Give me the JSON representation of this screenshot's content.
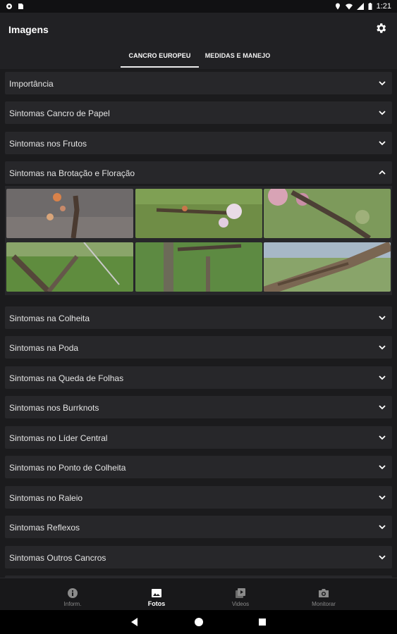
{
  "status_bar": {
    "time": "1:21",
    "icons": [
      "settings-notif-icon",
      "sd-card-icon",
      "location-icon",
      "wifi-icon",
      "signal-icon",
      "battery-icon"
    ]
  },
  "app_bar": {
    "title": "Imagens",
    "settings_icon": "gear-icon"
  },
  "tabs": [
    {
      "label": "CANCRO EUROPEU",
      "selected": true
    },
    {
      "label": "MEDIDAS E MANEJO",
      "selected": false
    }
  ],
  "sections": [
    {
      "label": "Importância",
      "expanded": false
    },
    {
      "label": "Sintomas Cancro de Papel",
      "expanded": false
    },
    {
      "label": "Sintomas nos Frutos",
      "expanded": false
    },
    {
      "label": "Sintomas na Brotação e Floração",
      "expanded": true
    },
    {
      "label": "Sintomas na Colheita",
      "expanded": false
    },
    {
      "label": "Sintomas na Poda",
      "expanded": false
    },
    {
      "label": "Sintomas na Queda de Folhas",
      "expanded": false
    },
    {
      "label": "Sintomas nos Burrknots",
      "expanded": false
    },
    {
      "label": "Sintomas no Líder Central",
      "expanded": false
    },
    {
      "label": "Sintomas no Ponto de Colheita",
      "expanded": false
    },
    {
      "label": "Sintomas no Raleio",
      "expanded": false
    },
    {
      "label": "Sintomas Reflexos",
      "expanded": false
    },
    {
      "label": "Sintomas Outros Cancros",
      "expanded": false
    }
  ],
  "gallery": {
    "thumbnails": [
      "photo-1",
      "photo-2",
      "photo-3",
      "photo-4",
      "photo-5",
      "photo-6"
    ]
  },
  "bottom_nav": [
    {
      "label": "Inform.",
      "icon": "info-icon",
      "active": false
    },
    {
      "label": "Fotos",
      "icon": "photo-icon",
      "active": true
    },
    {
      "label": "Videos",
      "icon": "video-library-icon",
      "active": false
    },
    {
      "label": "Monitorar",
      "icon": "camera-icon",
      "active": false
    }
  ],
  "system_nav": {
    "buttons": [
      "back-icon",
      "home-icon",
      "recents-icon"
    ]
  },
  "colors": {
    "background": "#1b1b1d",
    "appbar": "#212124",
    "row": "#27272a",
    "text": "#e4e4e4",
    "muted": "#8b8b8b"
  }
}
